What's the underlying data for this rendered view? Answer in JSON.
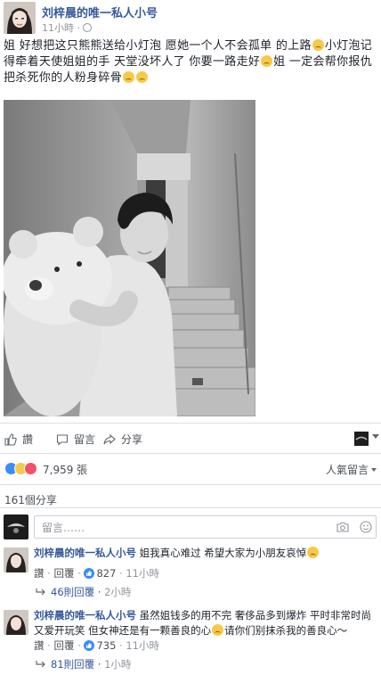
{
  "post": {
    "author": "刘梓晨的唯一私人小号",
    "time": "11小時",
    "text_parts": [
      "姐 好想把这只熊熊送给小灯泡 愿她一个人不会孤单 的上路",
      "小灯泡记得牵着天使姐姐的手 天堂没坏人了 你要一路走好",
      "姐 一定会帮你报仇 把杀死你的人粉身碎骨",
      ""
    ]
  },
  "actions": {
    "like": "讚",
    "comment": "留言",
    "share": "分享"
  },
  "reactions": {
    "count": "7,959 張",
    "sort": "人氣留言"
  },
  "shares": "161個分享",
  "composer": {
    "placeholder": "留言……"
  },
  "comments": [
    {
      "author": "刘梓晨的唯一私人小号",
      "text": "姐我真心难过 希望大家为小朋友哀悼",
      "like_label": "讚",
      "reply_label": "回覆",
      "likes": "827",
      "time": "11小時",
      "replies": "46則回覆",
      "replies_time": "2小時"
    },
    {
      "author": "刘梓晨的唯一私人小号",
      "text_a": "虽然姐钱多的用不完 奢侈品多到爆炸 平时非常时尚又爱开玩笑 但女神还是有一颗善良的心",
      "text_b": "请你们别抹杀我的善良心～",
      "like_label": "讚",
      "reply_label": "回覆",
      "likes": "735",
      "time": "11小時",
      "replies": "81則回覆",
      "replies_time": "1小時"
    }
  ],
  "icons": {
    "like": "thumbs-up-icon",
    "comment": "speech-bubble-icon",
    "share": "share-arrow-icon",
    "camera": "camera-icon",
    "sticker": "sticker-icon",
    "reply": "reply-arrow-icon"
  },
  "colors": {
    "link": "#365899",
    "meta": "#90949c",
    "like_reaction": "#3b8cf7",
    "love_reaction": "#f25268"
  }
}
